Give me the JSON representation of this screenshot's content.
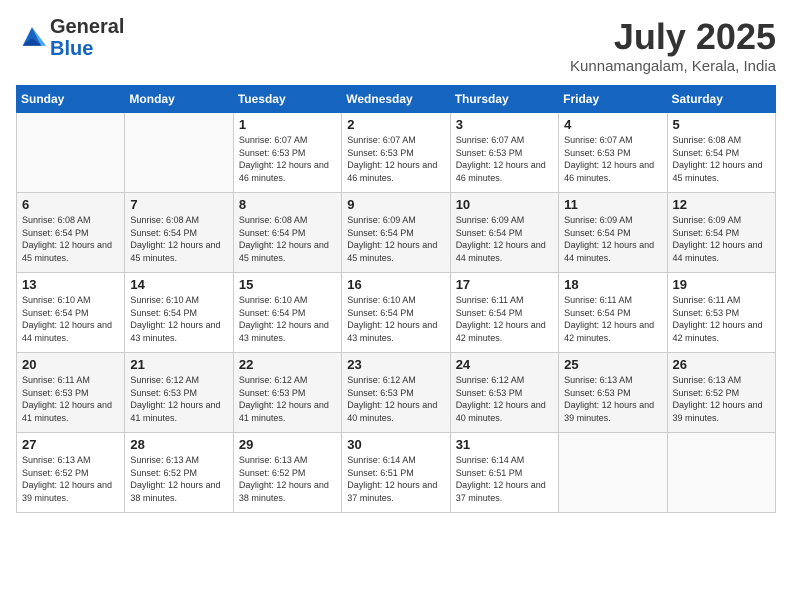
{
  "header": {
    "logo_line1": "General",
    "logo_line2": "Blue",
    "month": "July 2025",
    "location": "Kunnamangalam, Kerala, India"
  },
  "weekdays": [
    "Sunday",
    "Monday",
    "Tuesday",
    "Wednesday",
    "Thursday",
    "Friday",
    "Saturday"
  ],
  "weeks": [
    [
      {
        "day": "",
        "sunrise": "",
        "sunset": "",
        "daylight": ""
      },
      {
        "day": "",
        "sunrise": "",
        "sunset": "",
        "daylight": ""
      },
      {
        "day": "1",
        "sunrise": "Sunrise: 6:07 AM",
        "sunset": "Sunset: 6:53 PM",
        "daylight": "Daylight: 12 hours and 46 minutes."
      },
      {
        "day": "2",
        "sunrise": "Sunrise: 6:07 AM",
        "sunset": "Sunset: 6:53 PM",
        "daylight": "Daylight: 12 hours and 46 minutes."
      },
      {
        "day": "3",
        "sunrise": "Sunrise: 6:07 AM",
        "sunset": "Sunset: 6:53 PM",
        "daylight": "Daylight: 12 hours and 46 minutes."
      },
      {
        "day": "4",
        "sunrise": "Sunrise: 6:07 AM",
        "sunset": "Sunset: 6:53 PM",
        "daylight": "Daylight: 12 hours and 46 minutes."
      },
      {
        "day": "5",
        "sunrise": "Sunrise: 6:08 AM",
        "sunset": "Sunset: 6:54 PM",
        "daylight": "Daylight: 12 hours and 45 minutes."
      }
    ],
    [
      {
        "day": "6",
        "sunrise": "Sunrise: 6:08 AM",
        "sunset": "Sunset: 6:54 PM",
        "daylight": "Daylight: 12 hours and 45 minutes."
      },
      {
        "day": "7",
        "sunrise": "Sunrise: 6:08 AM",
        "sunset": "Sunset: 6:54 PM",
        "daylight": "Daylight: 12 hours and 45 minutes."
      },
      {
        "day": "8",
        "sunrise": "Sunrise: 6:08 AM",
        "sunset": "Sunset: 6:54 PM",
        "daylight": "Daylight: 12 hours and 45 minutes."
      },
      {
        "day": "9",
        "sunrise": "Sunrise: 6:09 AM",
        "sunset": "Sunset: 6:54 PM",
        "daylight": "Daylight: 12 hours and 45 minutes."
      },
      {
        "day": "10",
        "sunrise": "Sunrise: 6:09 AM",
        "sunset": "Sunset: 6:54 PM",
        "daylight": "Daylight: 12 hours and 44 minutes."
      },
      {
        "day": "11",
        "sunrise": "Sunrise: 6:09 AM",
        "sunset": "Sunset: 6:54 PM",
        "daylight": "Daylight: 12 hours and 44 minutes."
      },
      {
        "day": "12",
        "sunrise": "Sunrise: 6:09 AM",
        "sunset": "Sunset: 6:54 PM",
        "daylight": "Daylight: 12 hours and 44 minutes."
      }
    ],
    [
      {
        "day": "13",
        "sunrise": "Sunrise: 6:10 AM",
        "sunset": "Sunset: 6:54 PM",
        "daylight": "Daylight: 12 hours and 44 minutes."
      },
      {
        "day": "14",
        "sunrise": "Sunrise: 6:10 AM",
        "sunset": "Sunset: 6:54 PM",
        "daylight": "Daylight: 12 hours and 43 minutes."
      },
      {
        "day": "15",
        "sunrise": "Sunrise: 6:10 AM",
        "sunset": "Sunset: 6:54 PM",
        "daylight": "Daylight: 12 hours and 43 minutes."
      },
      {
        "day": "16",
        "sunrise": "Sunrise: 6:10 AM",
        "sunset": "Sunset: 6:54 PM",
        "daylight": "Daylight: 12 hours and 43 minutes."
      },
      {
        "day": "17",
        "sunrise": "Sunrise: 6:11 AM",
        "sunset": "Sunset: 6:54 PM",
        "daylight": "Daylight: 12 hours and 42 minutes."
      },
      {
        "day": "18",
        "sunrise": "Sunrise: 6:11 AM",
        "sunset": "Sunset: 6:54 PM",
        "daylight": "Daylight: 12 hours and 42 minutes."
      },
      {
        "day": "19",
        "sunrise": "Sunrise: 6:11 AM",
        "sunset": "Sunset: 6:53 PM",
        "daylight": "Daylight: 12 hours and 42 minutes."
      }
    ],
    [
      {
        "day": "20",
        "sunrise": "Sunrise: 6:11 AM",
        "sunset": "Sunset: 6:53 PM",
        "daylight": "Daylight: 12 hours and 41 minutes."
      },
      {
        "day": "21",
        "sunrise": "Sunrise: 6:12 AM",
        "sunset": "Sunset: 6:53 PM",
        "daylight": "Daylight: 12 hours and 41 minutes."
      },
      {
        "day": "22",
        "sunrise": "Sunrise: 6:12 AM",
        "sunset": "Sunset: 6:53 PM",
        "daylight": "Daylight: 12 hours and 41 minutes."
      },
      {
        "day": "23",
        "sunrise": "Sunrise: 6:12 AM",
        "sunset": "Sunset: 6:53 PM",
        "daylight": "Daylight: 12 hours and 40 minutes."
      },
      {
        "day": "24",
        "sunrise": "Sunrise: 6:12 AM",
        "sunset": "Sunset: 6:53 PM",
        "daylight": "Daylight: 12 hours and 40 minutes."
      },
      {
        "day": "25",
        "sunrise": "Sunrise: 6:13 AM",
        "sunset": "Sunset: 6:53 PM",
        "daylight": "Daylight: 12 hours and 39 minutes."
      },
      {
        "day": "26",
        "sunrise": "Sunrise: 6:13 AM",
        "sunset": "Sunset: 6:52 PM",
        "daylight": "Daylight: 12 hours and 39 minutes."
      }
    ],
    [
      {
        "day": "27",
        "sunrise": "Sunrise: 6:13 AM",
        "sunset": "Sunset: 6:52 PM",
        "daylight": "Daylight: 12 hours and 39 minutes."
      },
      {
        "day": "28",
        "sunrise": "Sunrise: 6:13 AM",
        "sunset": "Sunset: 6:52 PM",
        "daylight": "Daylight: 12 hours and 38 minutes."
      },
      {
        "day": "29",
        "sunrise": "Sunrise: 6:13 AM",
        "sunset": "Sunset: 6:52 PM",
        "daylight": "Daylight: 12 hours and 38 minutes."
      },
      {
        "day": "30",
        "sunrise": "Sunrise: 6:14 AM",
        "sunset": "Sunset: 6:51 PM",
        "daylight": "Daylight: 12 hours and 37 minutes."
      },
      {
        "day": "31",
        "sunrise": "Sunrise: 6:14 AM",
        "sunset": "Sunset: 6:51 PM",
        "daylight": "Daylight: 12 hours and 37 minutes."
      },
      {
        "day": "",
        "sunrise": "",
        "sunset": "",
        "daylight": ""
      },
      {
        "day": "",
        "sunrise": "",
        "sunset": "",
        "daylight": ""
      }
    ]
  ]
}
